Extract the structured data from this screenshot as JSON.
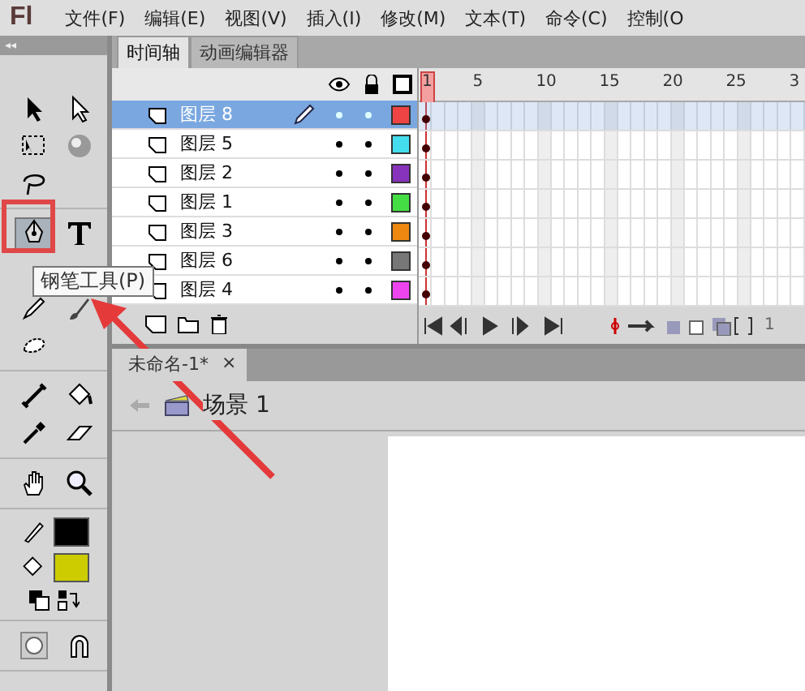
{
  "menu_bar": {
    "logo": "Fl",
    "items": [
      "文件(F)",
      "编辑(E)",
      "视图(V)",
      "插入(I)",
      "修改(M)",
      "文本(T)",
      "命令(C)",
      "控制(O"
    ]
  },
  "tools_panel": {
    "collapse": "◂◂",
    "groups": [
      [
        {
          "kind": "arrow",
          "selected": false
        },
        {
          "kind": "subselect",
          "selected": false
        },
        {
          "kind": "transform",
          "selected": false
        },
        {
          "kind": "sphere",
          "selected": false
        },
        {
          "kind": "lasso",
          "selected": false
        }
      ],
      [
        {
          "kind": "pen",
          "selected": true
        },
        {
          "kind": "text",
          "selected": false
        },
        {
          "kind": "pencil",
          "selected": false
        },
        {
          "kind": "brush",
          "selected": false
        },
        {
          "kind": "deco",
          "selected": false
        }
      ],
      [
        {
          "kind": "bone",
          "selected": false
        },
        {
          "kind": "bucket",
          "selected": false
        },
        {
          "kind": "eyedropper",
          "selected": false
        },
        {
          "kind": "eraser",
          "selected": false
        }
      ],
      [
        {
          "kind": "hand",
          "selected": false
        },
        {
          "kind": "zoom",
          "selected": false
        }
      ]
    ],
    "stroke": {
      "color": "#000000"
    },
    "fill": {
      "color": "#cccc00"
    },
    "bottom_tools": [
      {
        "kind": "snap",
        "selected": false
      },
      {
        "kind": "magnet",
        "selected": false
      }
    ],
    "tooltip": "钢笔工具(P)"
  },
  "timeline": {
    "tabs": [
      {
        "label": "时间轴",
        "selected": true
      },
      {
        "label": "动画编辑器",
        "selected": false
      }
    ],
    "ruler": [
      "1",
      "5",
      "10",
      "15",
      "20",
      "25",
      "3"
    ],
    "layers": [
      {
        "name": "图层 8",
        "selected": true,
        "color": "#ee4444"
      },
      {
        "name": "图层 5",
        "selected": false,
        "color": "#44ddee"
      },
      {
        "name": "图层 2",
        "selected": false,
        "color": "#8833bb"
      },
      {
        "name": "图层 1",
        "selected": false,
        "color": "#44dd44"
      },
      {
        "name": "图层 3",
        "selected": false,
        "color": "#ee8811"
      },
      {
        "name": "图层 6",
        "selected": false,
        "color": "#777777"
      },
      {
        "name": "图层 4",
        "selected": false,
        "color": "#ee44ee"
      }
    ],
    "current_frame": "1"
  },
  "document": {
    "tab": "未命名-1*",
    "close": "×",
    "scene": "场景 1"
  }
}
